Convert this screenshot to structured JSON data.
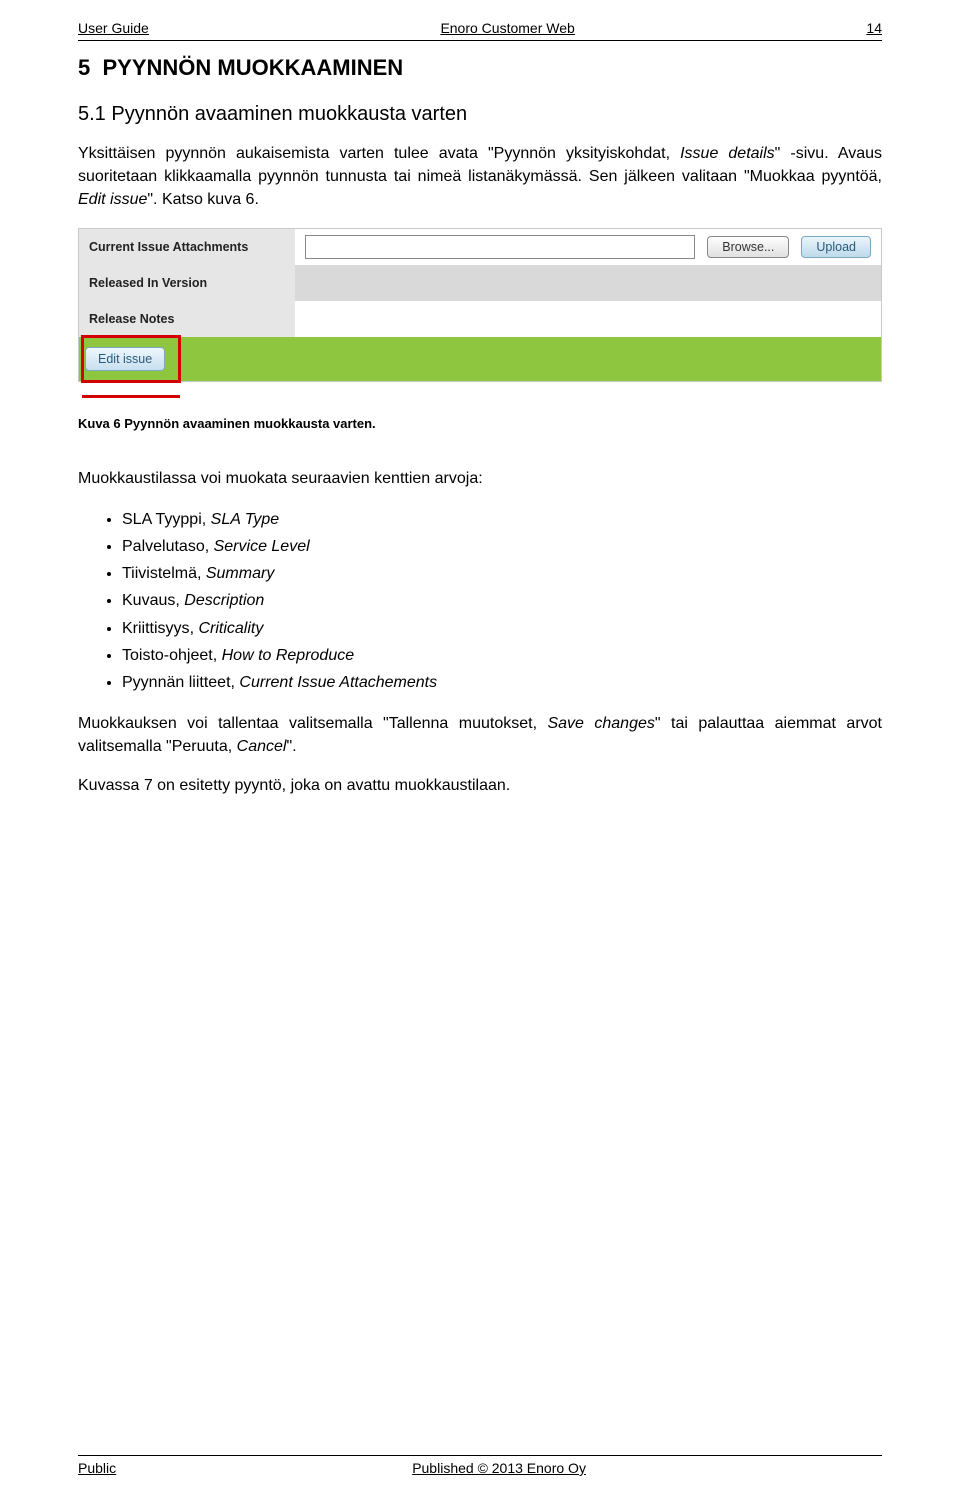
{
  "header": {
    "left": "User Guide",
    "center": "Enoro Customer Web",
    "right": "14"
  },
  "footer": {
    "left": "Public",
    "center": "Published © 2013 Enoro Oy"
  },
  "section": {
    "number": "5",
    "title": "PYYNNÖN MUOKKAAMINEN"
  },
  "subsection": {
    "number": "5.1",
    "title": "Pyynnön avaaminen muokkausta varten"
  },
  "para1_a": "Yksittäisen pyynnön aukaisemista varten tulee avata \"Pyynnön yksityiskohdat, ",
  "para1_i": "Issue details",
  "para1_b": "\" -sivu. Avaus suoritetaan klikkaamalla pyynnön tunnusta tai nimeä listanäkymässä. Sen jälkeen valitaan \"Muokkaa pyyntöä, ",
  "para1_i2": "Edit issue",
  "para1_c": "\". Katso kuva 6.",
  "shot": {
    "row1_label": "Current Issue Attachments",
    "browse_btn": "Browse...",
    "upload_btn": "Upload",
    "row2_label": "Released In Version",
    "row3_label": "Release Notes",
    "edit_btn": "Edit issue"
  },
  "caption": "Kuva 6 Pyynnön avaaminen muokkausta varten.",
  "intro_list": "Muokkaustilassa voi muokata seuraavien kenttien arvoja:",
  "fields": [
    {
      "fi": "SLA Tyyppi",
      "en": "SLA Type"
    },
    {
      "fi": "Palvelutaso",
      "en": "Service Level"
    },
    {
      "fi": "Tiivistelmä",
      "en": "Summary"
    },
    {
      "fi": "Kuvaus",
      "en": "Description"
    },
    {
      "fi": "Kriittisyys",
      "en": "Criticality"
    },
    {
      "fi": "Toisto-ohjeet",
      "en": "How to Reproduce"
    },
    {
      "fi": "Pyynnän liitteet",
      "en": "Current Issue Attachements"
    }
  ],
  "para2_a": "Muokkauksen voi tallentaa valitsemalla \"Tallenna muutokset, ",
  "para2_i": "Save changes",
  "para2_b": "\" tai palauttaa aiemmat arvot valitsemalla \"Peruuta, ",
  "para2_i2": "Cancel",
  "para2_c": "\".",
  "para3": "Kuvassa 7 on esitetty pyyntö, joka on avattu muokkaustilaan."
}
